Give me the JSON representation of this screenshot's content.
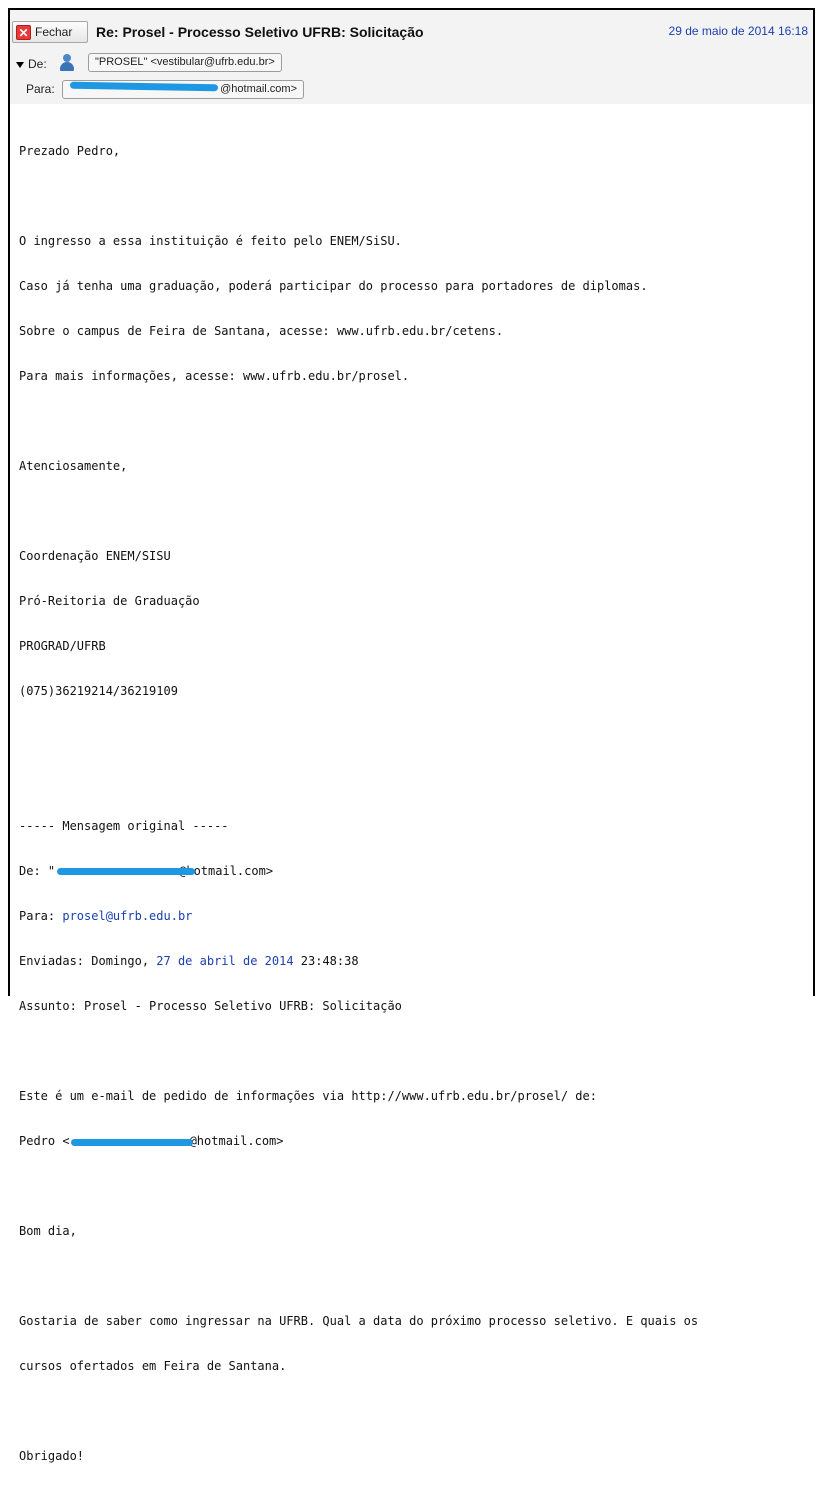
{
  "header": {
    "close_label": "Fechar",
    "subject": "Re: Prosel - Processo Seletivo UFRB: Solicitação",
    "date": "29 de maio de 2014 16:18",
    "from_label": "De:",
    "from_value": "\"PROSEL\" <vestibular@ufrb.edu.br>",
    "to_label": "Para:",
    "to_value": "@hotmail.com>"
  },
  "body": {
    "greeting": "Prezado Pedro,",
    "p1_l1": "O ingresso a essa instituição é feito pelo ENEM/SiSU.",
    "p1_l2": "Caso já tenha uma graduação, poderá participar do processo para portadores de diplomas.",
    "p1_l3": "Sobre o campus de Feira de Santana, acesse: www.ufrb.edu.br/cetens.",
    "p1_l4": "Para mais informações, acesse: www.ufrb.edu.br/prosel.",
    "closing": "Atenciosamente,",
    "sig1": "Coordenação ENEM/SISU",
    "sig2": "Pró-Reitoria de Graduação",
    "sig3": "PROGRAD/UFRB",
    "sig4": "(075)36219214/36219109"
  },
  "original": {
    "separator": "----- Mensagem original -----",
    "from_prefix": "De: \"",
    "from_suffix": "@hotmail.com>",
    "to_prefix": "Para: ",
    "to_email": "prosel@ufrb.edu.br",
    "sent_prefix": "Enviadas: Domingo, ",
    "sent_date": "27 de abril de 2014",
    "sent_time": " 23:48:38",
    "subject_line": "Assunto: Prosel - Processo Seletivo UFRB: Solicitação",
    "form_line": "Este é um e-mail de pedido de informações via http://www.ufrb.edu.br/prosel/ de:",
    "pedro_prefix": "Pedro <",
    "pedro_suffix": "@hotmail.com>",
    "hello": "Bom dia,",
    "q1": "Gostaria de saber como ingressar na UFRB. Qual a data do próximo processo seletivo. E quais os",
    "q2": "cursos ofertados em Feira de Santana.",
    "thanks": "Obrigado!"
  },
  "colors": {
    "redaction": "#1e98e3",
    "link": "#1a3fb0",
    "close_red": "#e5393a"
  }
}
